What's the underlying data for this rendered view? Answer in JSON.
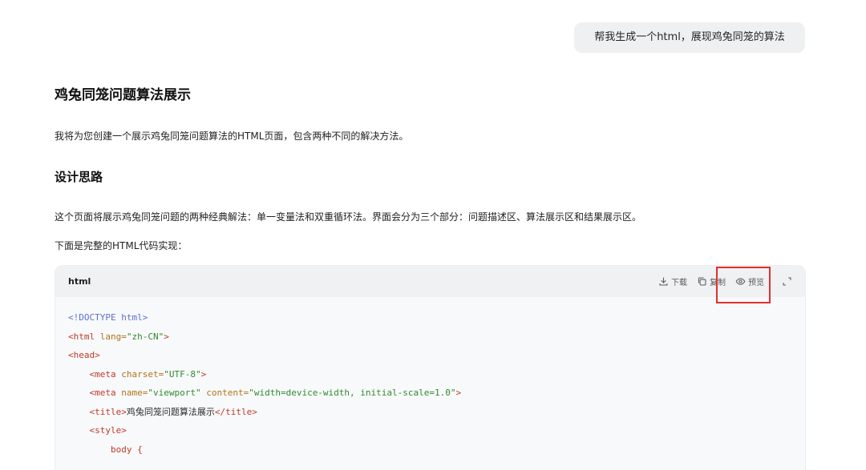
{
  "user_message": "帮我生成一个html，展现鸡兔同笼的算法",
  "response": {
    "title": "鸡兔同笼问题算法展示",
    "intro": "我将为您创建一个展示鸡兔同笼问题算法的HTML页面，包含两种不同的解决方法。",
    "section_title": "设计思路",
    "design_text": "这个页面将展示鸡兔同笼问题的两种经典解法：单一变量法和双重循环法。界面会分为三个部分：问题描述区、算法展示区和结果展示区。",
    "code_intro": "下面是完整的HTML代码实现："
  },
  "code_block": {
    "language": "html",
    "actions": {
      "download": "下载",
      "copy": "复制",
      "preview": "预览"
    },
    "lines": {
      "l1_doctype": "<!DOCTYPE html>",
      "l2_open": "<html ",
      "l2_attr": "lang=",
      "l2_val": "\"zh-CN\"",
      "l2_close": ">",
      "l3": "<head>",
      "l4_indent": "    ",
      "l4_open": "<meta ",
      "l4_attr": "charset=",
      "l4_val": "\"UTF-8\"",
      "l4_close": ">",
      "l5_indent": "    ",
      "l5_open": "<meta ",
      "l5_attr1": "name=",
      "l5_val1": "\"viewport\"",
      "l5_attr2": " content=",
      "l5_val2": "\"width=device-width, initial-scale=1.0\"",
      "l5_close": ">",
      "l6_indent": "    ",
      "l6_open": "<title>",
      "l6_text": "鸡兔同笼问题算法展示",
      "l6_close": "</title>",
      "l7_indent": "    ",
      "l7": "<style>",
      "l8_indent": "        ",
      "l8": "body {"
    }
  }
}
